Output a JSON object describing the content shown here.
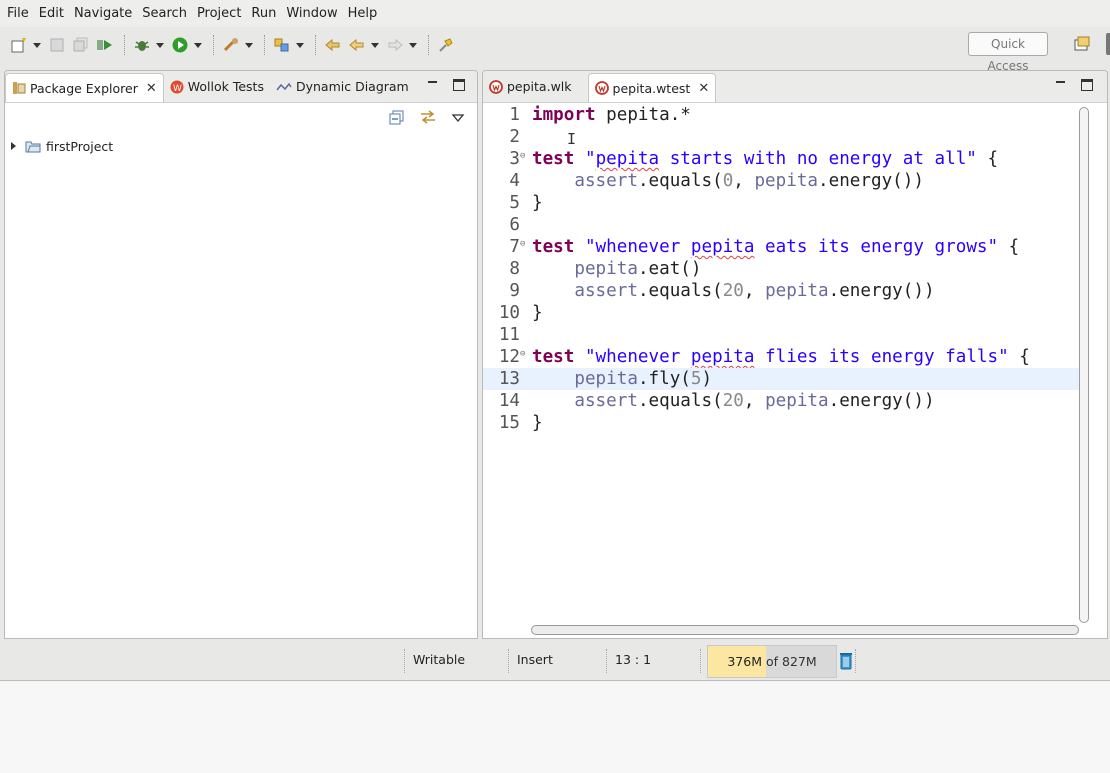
{
  "menu": [
    "File",
    "Edit",
    "Navigate",
    "Search",
    "Project",
    "Run",
    "Window",
    "Help"
  ],
  "toolbar": {
    "quick_access_placeholder": "Quick Access",
    "icons": [
      "new-icon",
      "save-icon",
      "save-all-icon",
      "run-wollok-icon",
      "debug-icon",
      "run-icon",
      "external-tools-icon",
      "open-type-icon",
      "prev-edit-icon",
      "back-icon",
      "forward-icon",
      "pin-icon",
      "open-perspective-icon"
    ]
  },
  "package_explorer": {
    "tabs": [
      {
        "label": "Package Explorer",
        "active": true
      },
      {
        "label": "Wollok Tests",
        "active": false
      },
      {
        "label": "Dynamic Diagram",
        "active": false
      }
    ],
    "tree": [
      {
        "label": "firstProject",
        "expanded": false
      }
    ]
  },
  "editor": {
    "tabs": [
      {
        "label": "pepita.wlk",
        "active": false
      },
      {
        "label": "pepita.wtest",
        "active": true
      }
    ],
    "current_line": 13,
    "lines": [
      "import pepita.*",
      "",
      "test \"pepita starts with no energy at all\" {",
      "    assert.equals(0, pepita.energy())",
      "}",
      "",
      "test \"whenever pepita eats its energy grows\" {",
      "    pepita.eat()",
      "    assert.equals(20, pepita.energy())",
      "}",
      "",
      "test \"whenever pepita flies its energy falls\" {",
      "    pepita.fly(5)",
      "    assert.equals(20, pepita.energy())",
      "}"
    ]
  },
  "status": {
    "writable": "Writable",
    "insert_mode": "Insert",
    "position": "13 : 1",
    "heap_used": "376M",
    "heap_total": "of 827M",
    "heap_used_fraction": 0.455
  },
  "colors": {
    "keyword": "#7f0055",
    "string": "#2a00ff",
    "object": "#6a6a9a",
    "current_line": "#e8f2fe",
    "heap_fill": "#fbe7a1"
  }
}
